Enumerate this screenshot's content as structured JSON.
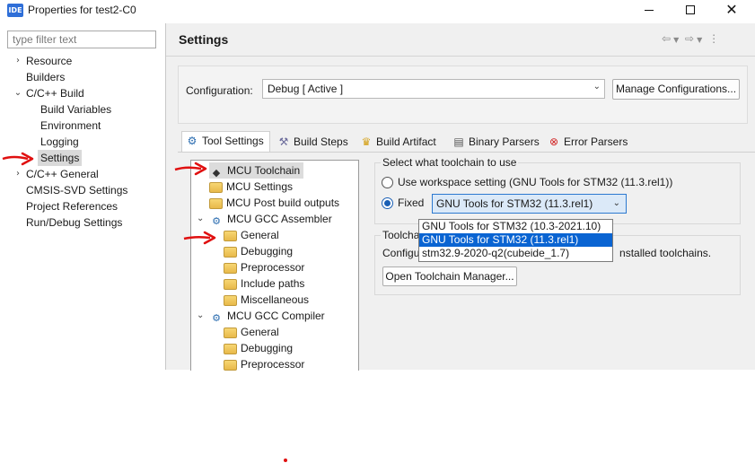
{
  "window": {
    "icon_text": "IDE",
    "title": "Properties for test2-C0",
    "minimize_icon": "minimize-icon",
    "maximize_icon": "maximize-icon",
    "close_icon": "close-icon"
  },
  "left_nav": {
    "filter_placeholder": "type filter text",
    "items": [
      {
        "label": "Resource",
        "expander": "›"
      },
      {
        "label": "Builders",
        "expander": ""
      },
      {
        "label": "C/C++ Build",
        "expander": "⌄"
      },
      {
        "label": "Build Variables",
        "expander": ""
      },
      {
        "label": "Environment",
        "expander": ""
      },
      {
        "label": "Logging",
        "expander": ""
      },
      {
        "label": "Settings",
        "expander": ""
      },
      {
        "label": "C/C++ General",
        "expander": "›"
      },
      {
        "label": "CMSIS-SVD Settings",
        "expander": ""
      },
      {
        "label": "Project References",
        "expander": ""
      },
      {
        "label": "Run/Debug Settings",
        "expander": ""
      }
    ],
    "selected": "Settings"
  },
  "header": {
    "title": "Settings",
    "nav_icons": [
      "back-arrow-icon",
      "forward-arrow-icon",
      "more-vertical-icon"
    ]
  },
  "configuration": {
    "label": "Configuration:",
    "value": "Debug  [ Active ]",
    "manage_button": "Manage Configurations..."
  },
  "tabs": [
    {
      "label": "Tool Settings",
      "icon": "gear-icon",
      "active": true
    },
    {
      "label": "Build Steps",
      "icon": "hammer-icon",
      "active": false
    },
    {
      "label": "Build Artifact",
      "icon": "trophy-icon",
      "active": false
    },
    {
      "label": "Binary Parsers",
      "icon": "binary-icon",
      "active": false
    },
    {
      "label": "Error Parsers",
      "icon": "error-icon",
      "active": false
    }
  ],
  "tool_tree": {
    "items": [
      {
        "label": "MCU Toolchain",
        "icon": "chip-icon"
      },
      {
        "label": "MCU Settings",
        "icon": "folder-icon"
      },
      {
        "label": "MCU Post build outputs",
        "icon": "folder-icon"
      },
      {
        "label": "MCU GCC Assembler",
        "icon": "gear-icon"
      },
      {
        "label": "General",
        "icon": "folder-icon"
      },
      {
        "label": "Debugging",
        "icon": "folder-icon"
      },
      {
        "label": "Preprocessor",
        "icon": "folder-icon"
      },
      {
        "label": "Include paths",
        "icon": "folder-icon"
      },
      {
        "label": "Miscellaneous",
        "icon": "folder-icon"
      },
      {
        "label": "MCU GCC Compiler",
        "icon": "gear-icon"
      },
      {
        "label": "General",
        "icon": "folder-icon"
      },
      {
        "label": "Debugging",
        "icon": "folder-icon"
      },
      {
        "label": "Preprocessor",
        "icon": "folder-icon"
      }
    ],
    "selected": "MCU Toolchain"
  },
  "toolchain": {
    "group_title": "Select what toolchain to use",
    "workspace_option": "Use workspace setting (GNU Tools for STM32 (11.3.rel1))",
    "fixed_option": "Fixed",
    "selected_option": "fixed",
    "combo_value": "GNU Tools for STM32 (11.3.rel1)",
    "dropdown_options": [
      "GNU Tools for STM32 (10.3-2021.10)",
      "GNU Tools for STM32 (11.3.rel1)",
      "stm32.9-2020-q2(cubeide_1.7)"
    ],
    "highlighted_option": "GNU Tools for STM32 (11.3.rel1)"
  },
  "toolchain_manager": {
    "group_title": "Toolchain",
    "description_start": "Configure",
    "description_end": "nstalled toolchains.",
    "open_button": "Open Toolchain Manager..."
  },
  "colors": {
    "annotation_red": "#e01010",
    "highlight_blue": "#0a64d2",
    "accent_blue": "#2c79d0"
  }
}
